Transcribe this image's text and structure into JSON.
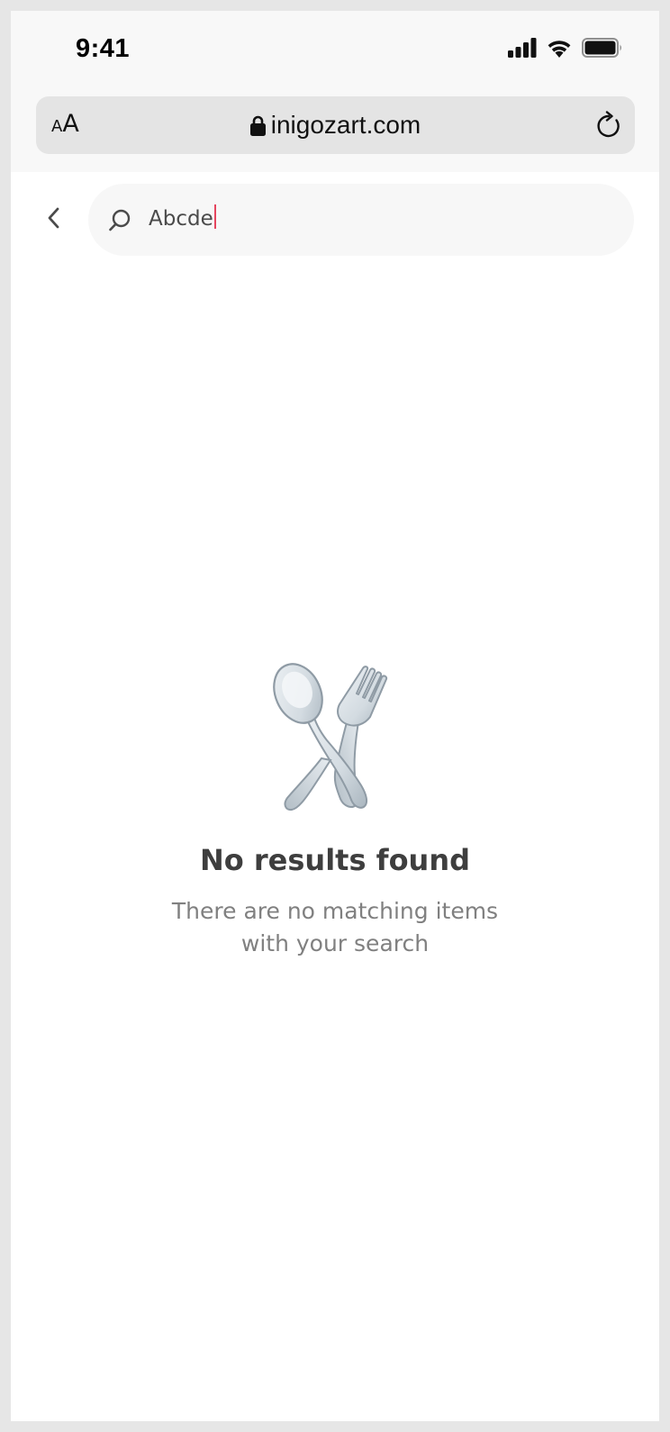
{
  "status_bar": {
    "time": "9:41",
    "icons": [
      "signal-icon",
      "wifi-icon",
      "battery-icon"
    ]
  },
  "browser": {
    "text_size_small": "A",
    "text_size_big": "A",
    "url": "inigozart.com",
    "icons": [
      "lock-icon",
      "reload-icon"
    ]
  },
  "search": {
    "value": "Abcde",
    "icons": [
      "back-icon",
      "search-icon"
    ],
    "caret_color": "#e5455e"
  },
  "empty_state": {
    "icon": "spoon-fork-icon",
    "title": "No results found",
    "description_line1": "There are no matching items",
    "description_line2": "with your search"
  },
  "colors": {
    "title": "#3e3e3e",
    "description": "#808080",
    "search_bg": "#f7f7f7"
  }
}
